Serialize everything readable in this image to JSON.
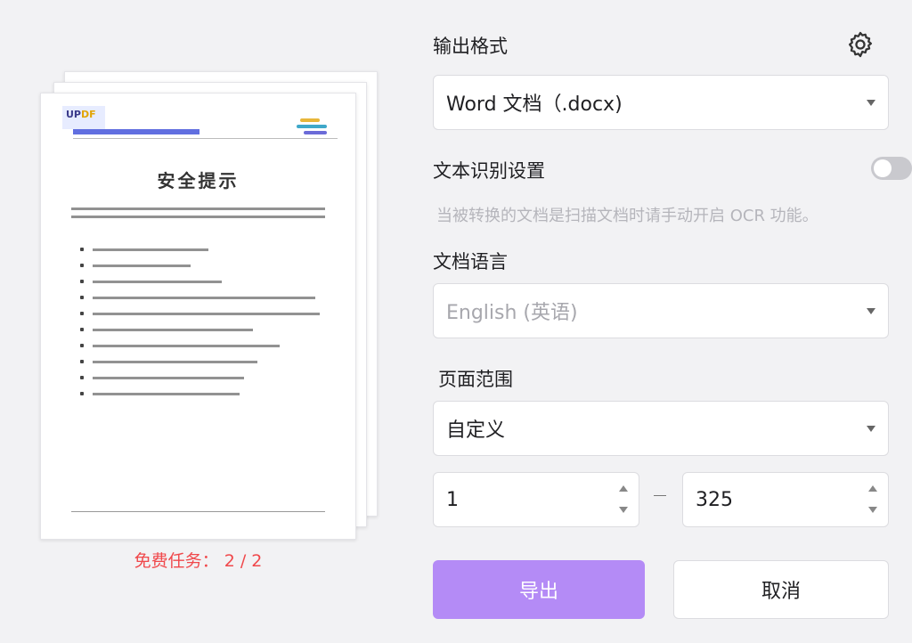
{
  "preview": {
    "doc_logo_part1": "UP",
    "doc_logo_part2": "DF",
    "doc_title": "安全提示",
    "free_tasks_label": "免费任务：",
    "free_tasks_count": "2 / 2",
    "free_tasks_color": "#f0484b"
  },
  "panel": {
    "output_format_label": "输出格式",
    "settings_icon": "gear-icon",
    "output_format_value": "Word 文档（.docx)",
    "ocr_label": "文本识别设置",
    "ocr_enabled": false,
    "ocr_hint": "当被转换的文档是扫描文档时请手动开启 OCR 功能。",
    "language_label": "文档语言",
    "language_value": "English (英语)",
    "page_range_label": "页面范围",
    "page_range_value": "自定义",
    "page_from": "1",
    "page_to": "325",
    "range_separator": "–",
    "export_button": "导出",
    "cancel_button": "取消",
    "accent_color": "#b48bf6"
  }
}
